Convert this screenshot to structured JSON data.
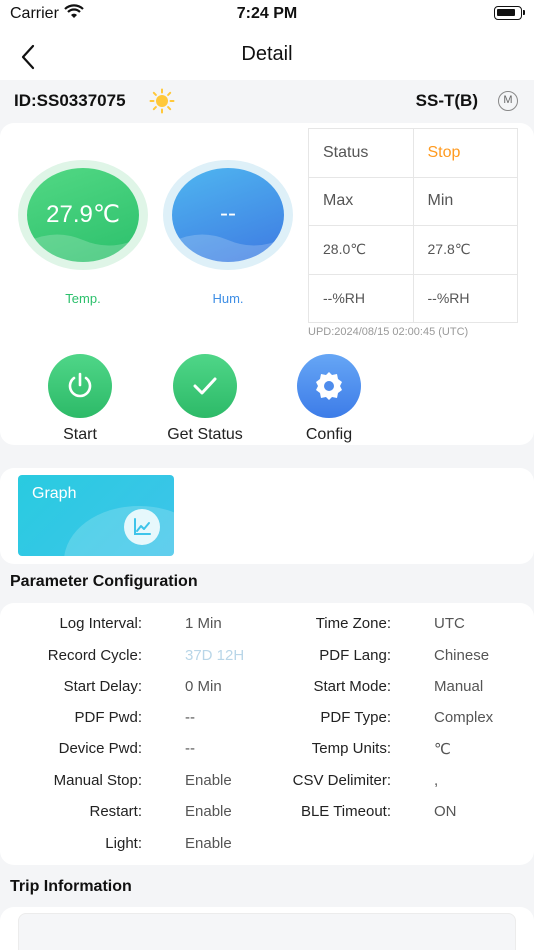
{
  "status_bar": {
    "carrier": "Carrier",
    "time": "7:24 PM"
  },
  "nav": {
    "title": "Detail"
  },
  "device": {
    "id": "ID:SS0337075",
    "model": "SS-T(B)",
    "badge": "M"
  },
  "gauges": {
    "temp": {
      "value": "27.9℃",
      "label": "Temp."
    },
    "hum": {
      "value": "--",
      "label": "Hum."
    }
  },
  "status_table": [
    [
      "Status",
      "Stop"
    ],
    [
      "Max",
      "Min"
    ],
    [
      "28.0℃",
      "27.8℃"
    ],
    [
      "--%RH",
      "--%RH"
    ]
  ],
  "updated": "UPD:2024/08/15 02:00:45 (UTC)",
  "actions": {
    "start": "Start",
    "get_status": "Get Status",
    "config": "Config"
  },
  "graph": {
    "label": "Graph"
  },
  "parameter_section": "Parameter Configuration",
  "parameters_left": [
    {
      "label": "Log Interval:",
      "value": "1 Min"
    },
    {
      "label": "Record Cycle:",
      "value": "37D 12H"
    },
    {
      "label": "Start Delay:",
      "value": "0 Min"
    },
    {
      "label": "PDF Pwd:",
      "value": "--"
    },
    {
      "label": "Device Pwd:",
      "value": "--"
    },
    {
      "label": "Manual Stop:",
      "value": "Enable"
    },
    {
      "label": "Restart:",
      "value": "Enable"
    },
    {
      "label": "Light:",
      "value": "Enable"
    }
  ],
  "parameters_right": [
    {
      "label": "Time Zone:",
      "value": "UTC"
    },
    {
      "label": "PDF Lang:",
      "value": "Chinese"
    },
    {
      "label": "Start Mode:",
      "value": "Manual"
    },
    {
      "label": "PDF Type:",
      "value": "Complex"
    },
    {
      "label": "Temp Units:",
      "value": "℃"
    },
    {
      "label": "CSV Delimiter:",
      "value": ","
    },
    {
      "label": "BLE Timeout:",
      "value": "ON"
    }
  ],
  "trip_section": "Trip Information"
}
